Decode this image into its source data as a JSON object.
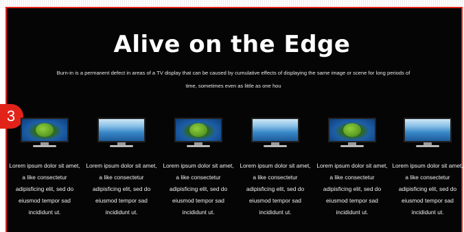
{
  "hero": {
    "title": "Alive on the Edge",
    "description": "Burn-in is a permanent defect in areas of a TV display that can be caused by cumulative effects of displaying the same image or scene for long periods of time, sometimes even as little as one hou"
  },
  "section_badge": "3",
  "products": [
    {
      "image": "tv-green-leaf",
      "text": "Lorem ipsum dolor sit amet, a like consectetur adipisficing elit, sed do eiusmod tempor sad incididunt ut."
    },
    {
      "image": "tv-blue-sky",
      "text": "Lorem ipsum dolor sit amet, a like consectetur adipisficing elit, sed do eiusmod tempor sad incididunt ut."
    },
    {
      "image": "tv-green-leaf",
      "text": "Lorem ipsum dolor sit amet, a like consectetur adipisficing elit, sed do eiusmod tempor sad incididunt ut."
    },
    {
      "image": "tv-blue-sky",
      "text": "Lorem ipsum dolor sit amet, a like consectetur adipisficing elit, sed do eiusmod tempor sad incididunt ut."
    },
    {
      "image": "tv-green-leaf",
      "text": "Lorem ipsum dolor sit amet, a like consectetur adipisficing elit, sed do eiusmod tempor sad incididunt ut."
    },
    {
      "image": "tv-blue-sky",
      "text": "Lorem ipsum dolor sit amet, a like consectetur adipisficing elit, sed do eiusmod tempor sad incididunt ut."
    }
  ],
  "colors": {
    "background": "#050505",
    "accent": "#e2231a",
    "text": "#ffffff"
  }
}
